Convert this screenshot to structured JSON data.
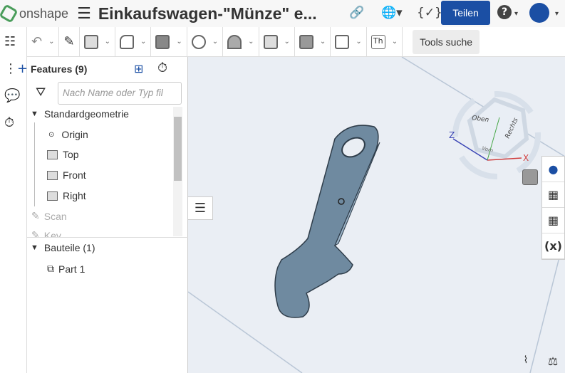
{
  "header": {
    "brand": "onshape",
    "title": "Einkaufswagen-\"Münze\" e...",
    "share_label": "Teilen",
    "help": "?"
  },
  "toolbar": {
    "search_label": "Tools suche",
    "text_tool": "Th"
  },
  "features": {
    "title": "Features (9)",
    "filter_placeholder": "Nach Name oder Typ fil",
    "group": "Standardgeometrie",
    "items": [
      "Origin",
      "Top",
      "Front",
      "Right"
    ],
    "more": [
      "Scan",
      "Key"
    ]
  },
  "parts": {
    "title": "Bauteile (1)",
    "items": [
      "Part 1"
    ]
  },
  "viewcube": {
    "top": "Oben",
    "right": "Rechts",
    "front": "Vorn",
    "x": "X",
    "z": "Z"
  }
}
